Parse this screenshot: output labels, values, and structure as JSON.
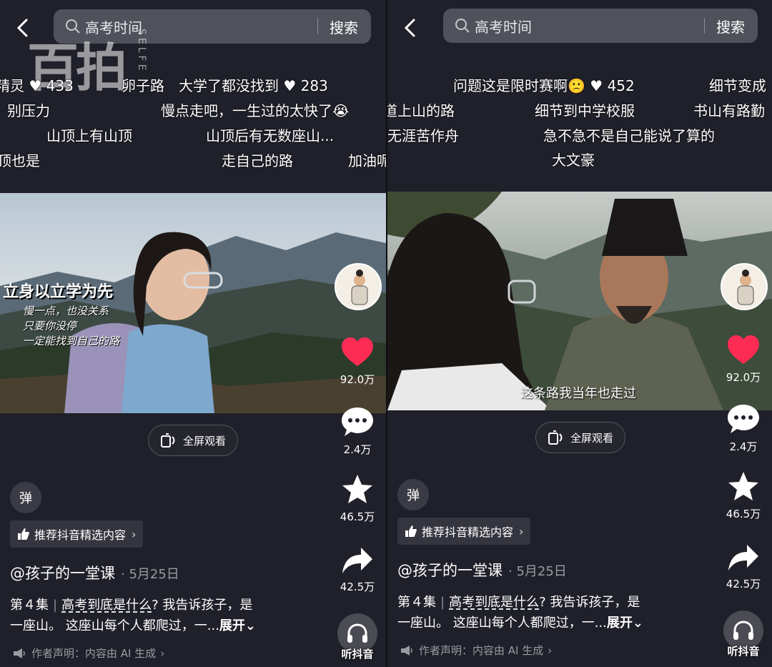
{
  "search": {
    "query": "高考时间",
    "button": "搜索"
  },
  "left": {
    "watermark": "百拍",
    "watermark_side": "SELFE",
    "danmaku": [
      {
        "text": "精灵",
        "likes": "433"
      },
      {
        "text": "卵子路"
      },
      {
        "text": "大学了都没找到",
        "likes": "283"
      },
      {
        "text": "别压力"
      },
      {
        "text": "慢点走吧，一生过的太快了😭"
      },
      {
        "text": "山顶上有山顶"
      },
      {
        "text": "山顶后有无数座山..."
      },
      {
        "text": "顶也是"
      },
      {
        "text": "走自己的路"
      },
      {
        "text": "加油呢?"
      }
    ],
    "video_title": "立身以立学为先",
    "video_lines": [
      "慢一点，也没关系",
      "只要你没停",
      "一定能找到自己的路"
    ],
    "likes": "92.0万",
    "comments": "2.4万",
    "favorites": "46.5万",
    "shares": "42.5万",
    "fullscreen": "全屏观看",
    "dan_button": "弹",
    "recommend": "推荐抖音精选内容",
    "author": "@孩子的一堂课",
    "date": "· 5月25日",
    "episode": "第４集",
    "topic": "高考到底是什么",
    "desc_rest": "? 我告诉孩子，是",
    "desc_line2": "一座山。 这座山每个人都爬过，一...",
    "expand": "展开",
    "declaration": "作者声明：内容由 AI 生成",
    "listen": "听抖音"
  },
  "right": {
    "danmaku": [
      {
        "text": "问题这是限时赛啊🙁",
        "likes": "452"
      },
      {
        "text": "细节变成"
      },
      {
        "text": "道上山的路"
      },
      {
        "text": "细节到中学校服"
      },
      {
        "text": "书山有路勤"
      },
      {
        "text": "无涯苦作舟"
      },
      {
        "text": "急不急不是自己能说了算的"
      },
      {
        "text": "大文豪"
      }
    ],
    "subtitle": "这条路我当年也走过",
    "likes": "92.0万",
    "comments": "2.4万",
    "favorites": "46.5万",
    "shares": "42.5万",
    "fullscreen": "全屏观看",
    "dan_button": "弹",
    "recommend": "推荐抖音精选内容",
    "author": "@孩子的一堂课",
    "date": "· 5月25日",
    "episode": "第４集",
    "topic": "高考到底是什么",
    "desc_rest": "? 我告诉孩子，是",
    "desc_line2": "一座山。 这座山每个人都爬过，一...",
    "expand": "展开",
    "declaration": "作者声明：内容由 AI 生成",
    "listen": "听抖音"
  },
  "colors": {
    "like": "#fe2c55",
    "panel_bg": "#1f2029",
    "search_bg": "#50525b"
  }
}
